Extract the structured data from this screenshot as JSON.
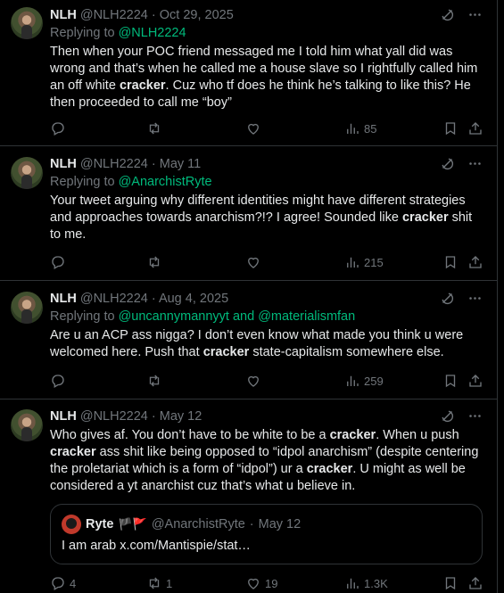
{
  "tweets": [
    {
      "name": "NLH",
      "handle": "@NLH2224",
      "date": "Oct 29, 2025",
      "replying_prefix": "Replying to",
      "replying_to": [
        "@NLH2224"
      ],
      "text_parts": [
        {
          "t": "Then when your POC friend messaged me I told him what yall did was wrong and that’s when he called me a house slave so I rightfully called him an off white "
        },
        {
          "t": "cracker",
          "b": true
        },
        {
          "t": ". Cuz who tf does he think he’s talking to like this? He then proceeded to call me “boy”"
        }
      ],
      "replies": "",
      "retweets": "",
      "likes": "",
      "views": "85"
    },
    {
      "name": "NLH",
      "handle": "@NLH2224",
      "date": "May 11",
      "replying_prefix": "Replying to",
      "replying_to": [
        "@AnarchistRyte"
      ],
      "text_parts": [
        {
          "t": "Your tweet arguing why different identities might have different strategies and approaches towards anarchism?!? I agree! Sounded like "
        },
        {
          "t": "cracker",
          "b": true
        },
        {
          "t": " shit to me."
        }
      ],
      "replies": "",
      "retweets": "",
      "likes": "",
      "views": "215"
    },
    {
      "name": "NLH",
      "handle": "@NLH2224",
      "date": "Aug 4, 2025",
      "replying_prefix": "Replying to",
      "replying_to": [
        "@uncannymannyyt",
        "and",
        "@materialismfan"
      ],
      "text_parts": [
        {
          "t": "Are u an ACP ass nigga? I don’t even know what made you think u were welcomed here. Push that "
        },
        {
          "t": "cracker",
          "b": true
        },
        {
          "t": " state-capitalism somewhere else."
        }
      ],
      "replies": "",
      "retweets": "",
      "likes": "",
      "views": "259"
    },
    {
      "name": "NLH",
      "handle": "@NLH2224",
      "date": "May 12",
      "replying_prefix": "",
      "replying_to": [],
      "text_parts": [
        {
          "t": "Who gives af. You don’t have to be white to be a "
        },
        {
          "t": "cracker",
          "b": true
        },
        {
          "t": ". When u push "
        },
        {
          "t": "cracker",
          "b": true
        },
        {
          "t": " ass shit like being opposed to “idpol anarchism” (despite centering the proletariat which is a form of “idpol”) ur  a "
        },
        {
          "t": "cracker",
          "b": true
        },
        {
          "t": ". U might as well be considered a yt anarchist cuz that’s what u believe in."
        }
      ],
      "quote": {
        "name": "Ryte",
        "flags": "🏴🚩",
        "handle": "@AnarchistRyte",
        "date": "May 12",
        "text": "I am arab x.com/Mantispie/stat…"
      },
      "replies": "4",
      "retweets": "1",
      "likes": "19",
      "views": "1.3K"
    }
  ],
  "separator": "·",
  "colors": {
    "background": "#000000",
    "text": "#e7e9ea",
    "muted": "#71767b",
    "link": "#1d9bf0",
    "border": "#2f3336"
  },
  "icons": [
    "grok-icon",
    "more-icon",
    "reply-icon",
    "retweet-icon",
    "like-icon",
    "views-icon",
    "bookmark-icon",
    "share-icon"
  ]
}
